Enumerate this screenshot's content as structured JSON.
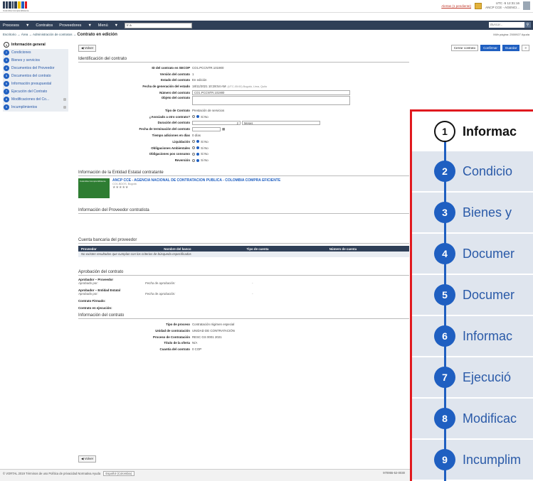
{
  "header": {
    "logo_caption": "Colombia Compra Eficiente",
    "alert_link": "Alertas (1 pendiente)",
    "utc": "UTC -5 12:31:16",
    "user": "ANCP CCE - AGENCI..."
  },
  "nav": {
    "items": [
      "Procesos",
      "Contratos",
      "Proveedores",
      "Menú"
    ],
    "select_value": "Ir a",
    "search_placeholder": "Buscar..."
  },
  "breadcrumb": {
    "path": "Escritorio → Área → Administración de contratos → ",
    "current": "Contrato en edición"
  },
  "page_info": "Mi/ir página: 2500927  Ayuda",
  "sidebar": {
    "items": [
      {
        "num": "1",
        "label": "Información general",
        "active": true
      },
      {
        "num": "2",
        "label": "Condiciones"
      },
      {
        "num": "3",
        "label": "Bienes y servicios"
      },
      {
        "num": "4",
        "label": "Documentos del Proveedor"
      },
      {
        "num": "5",
        "label": "Documentos del contrato"
      },
      {
        "num": "6",
        "label": "Información presupuestal"
      },
      {
        "num": "7",
        "label": "Ejecución del Contrato"
      },
      {
        "num": "8",
        "label": "Modificaciones del Co..."
      },
      {
        "num": "9",
        "label": "Incumplimientos"
      }
    ]
  },
  "buttons": {
    "volver": "Volver",
    "cerrar": "Cerrar contrato",
    "confirmar": "Confirmar",
    "guardar": "Guardar",
    "next": ">"
  },
  "section_ident": {
    "title": "Identificación del contrato",
    "rows": [
      {
        "label": "ID del contrato en SECOP",
        "value": "CO1.PCCNTR.101900"
      },
      {
        "label": "Versión del contrato",
        "value": "1"
      },
      {
        "label": "Estado del contrato",
        "value": "En edición"
      },
      {
        "label": "Fecha de generación del estado",
        "value": "18/11/2021 10:28:54 AM"
      },
      {
        "label": "Número del contrato",
        "value": "CO1.PCCNTR.101900"
      },
      {
        "label": "Objeto del contrato",
        "value": ""
      },
      {
        "label": "Tipo de Contrato",
        "value": "Prestación de servicios"
      },
      {
        "label": "¿Asociado a otro contrato?",
        "value": "Si  No"
      },
      {
        "label": "Duración del contrato",
        "value": "2",
        "unit": "Meses"
      },
      {
        "label": "Fecha de terminación del contrato",
        "value": ""
      },
      {
        "label": "Tiempo adiciones en días",
        "value": "0 días"
      },
      {
        "label": "Liquidación",
        "value": "Si  No"
      },
      {
        "label": "Obligaciones Ambientales",
        "value": "Si  No"
      },
      {
        "label": "Obligaciones pos consumo",
        "value": "Si  No"
      },
      {
        "label": "Reversión",
        "value": "Si  No"
      }
    ],
    "timezone_note": "(UTC-05:00) Bogotá, Lima, Quito"
  },
  "section_entity": {
    "title": "Información de la Entidad Estatal contratante",
    "name": "ANCP CCE - AGENCIA NACIONAL DE CONTRATACION PUBLICA - COLOMBIA COMPRA EFICIENTE",
    "sub": "CO1.BDOS. Bogotá",
    "stars": "★★★★★",
    "logo_text": "Colombia Compra Eficiente"
  },
  "section_provider": {
    "title": "Información del Proveedor contratista"
  },
  "section_bank": {
    "title": "Cuenta bancaria del proveedor",
    "columns": [
      "Proveedor",
      "Nombre del banco",
      "Tipo de cuenta",
      "Número de cuenta"
    ],
    "empty": "No existen resultados que cumplan con los criterios de búsqueda especificados"
  },
  "section_approval": {
    "title": "Aprobación del contrato",
    "items": [
      {
        "title": "Aprobador – Proveedor",
        "by": "Aprobado por:",
        "date": "Fecha de aprobación:",
        "dash": "-"
      },
      {
        "title": "Aprobador – Entidad Estatal",
        "by": "Aprobado por:",
        "date": "Fecha de aprobación:",
        "dash": "-"
      }
    ],
    "signed": "Contrato Firmado:",
    "execution": "Contrato en ejecución:"
  },
  "section_info": {
    "title": "Información del contrato",
    "rows": [
      {
        "label": "Tipo de proceso",
        "value": "Contratación régimen especial"
      },
      {
        "label": "Unidad de contratación",
        "value": "UNIDAD DE CONTRATACIÓN"
      },
      {
        "label": "Proceso de Contratación",
        "value": "RESC GS 0001 2021"
      },
      {
        "label": "Título de la oferta",
        "value": "N/A"
      },
      {
        "label": "Cuantía del contrato",
        "value": "0 COP"
      }
    ]
  },
  "footer": {
    "text": "© VORTAL 2019  Términos de uso  Política de privacidad  Normativa  Ayuda",
    "language": "Español (Colombia)",
    "code": "970955-52-0030"
  },
  "zoom": {
    "items": [
      {
        "num": "1",
        "label": "Informac"
      },
      {
        "num": "2",
        "label": "Condicio"
      },
      {
        "num": "3",
        "label": "Bienes y"
      },
      {
        "num": "4",
        "label": "Documer"
      },
      {
        "num": "5",
        "label": "Documer"
      },
      {
        "num": "6",
        "label": "Informac"
      },
      {
        "num": "7",
        "label": "Ejecució"
      },
      {
        "num": "8",
        "label": "Modificac"
      },
      {
        "num": "9",
        "label": "Incumplim"
      }
    ]
  },
  "colors": {
    "navy": "#2f3f57",
    "blue": "#1f5fc1",
    "red": "#e0191e"
  }
}
